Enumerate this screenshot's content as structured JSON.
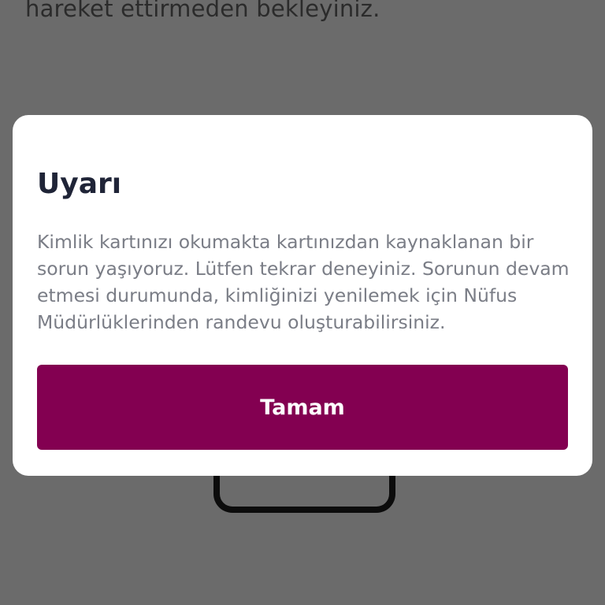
{
  "background": {
    "instruction_text": "hareket ettirmeden bekleyiniz."
  },
  "dialog": {
    "title": "Uyarı",
    "message": "Kimlik kartınızı okumakta kartınızdan kaynaklanan bir sorun yaşıyoruz. Lütfen tekrar deneyiniz. Sorunun devam etmesi durumunda, kimliğinizi yenilemek için Nüfus Müdürlüklerinden randevu oluşturabilirsiniz.",
    "ok_button_label": "Tamam"
  },
  "colors": {
    "overlay": "#6b6b6b",
    "dialog_background": "#ffffff",
    "title": "#1f2437",
    "message": "#7a7d86",
    "button_background": "#830051",
    "button_text": "#ffffff"
  }
}
